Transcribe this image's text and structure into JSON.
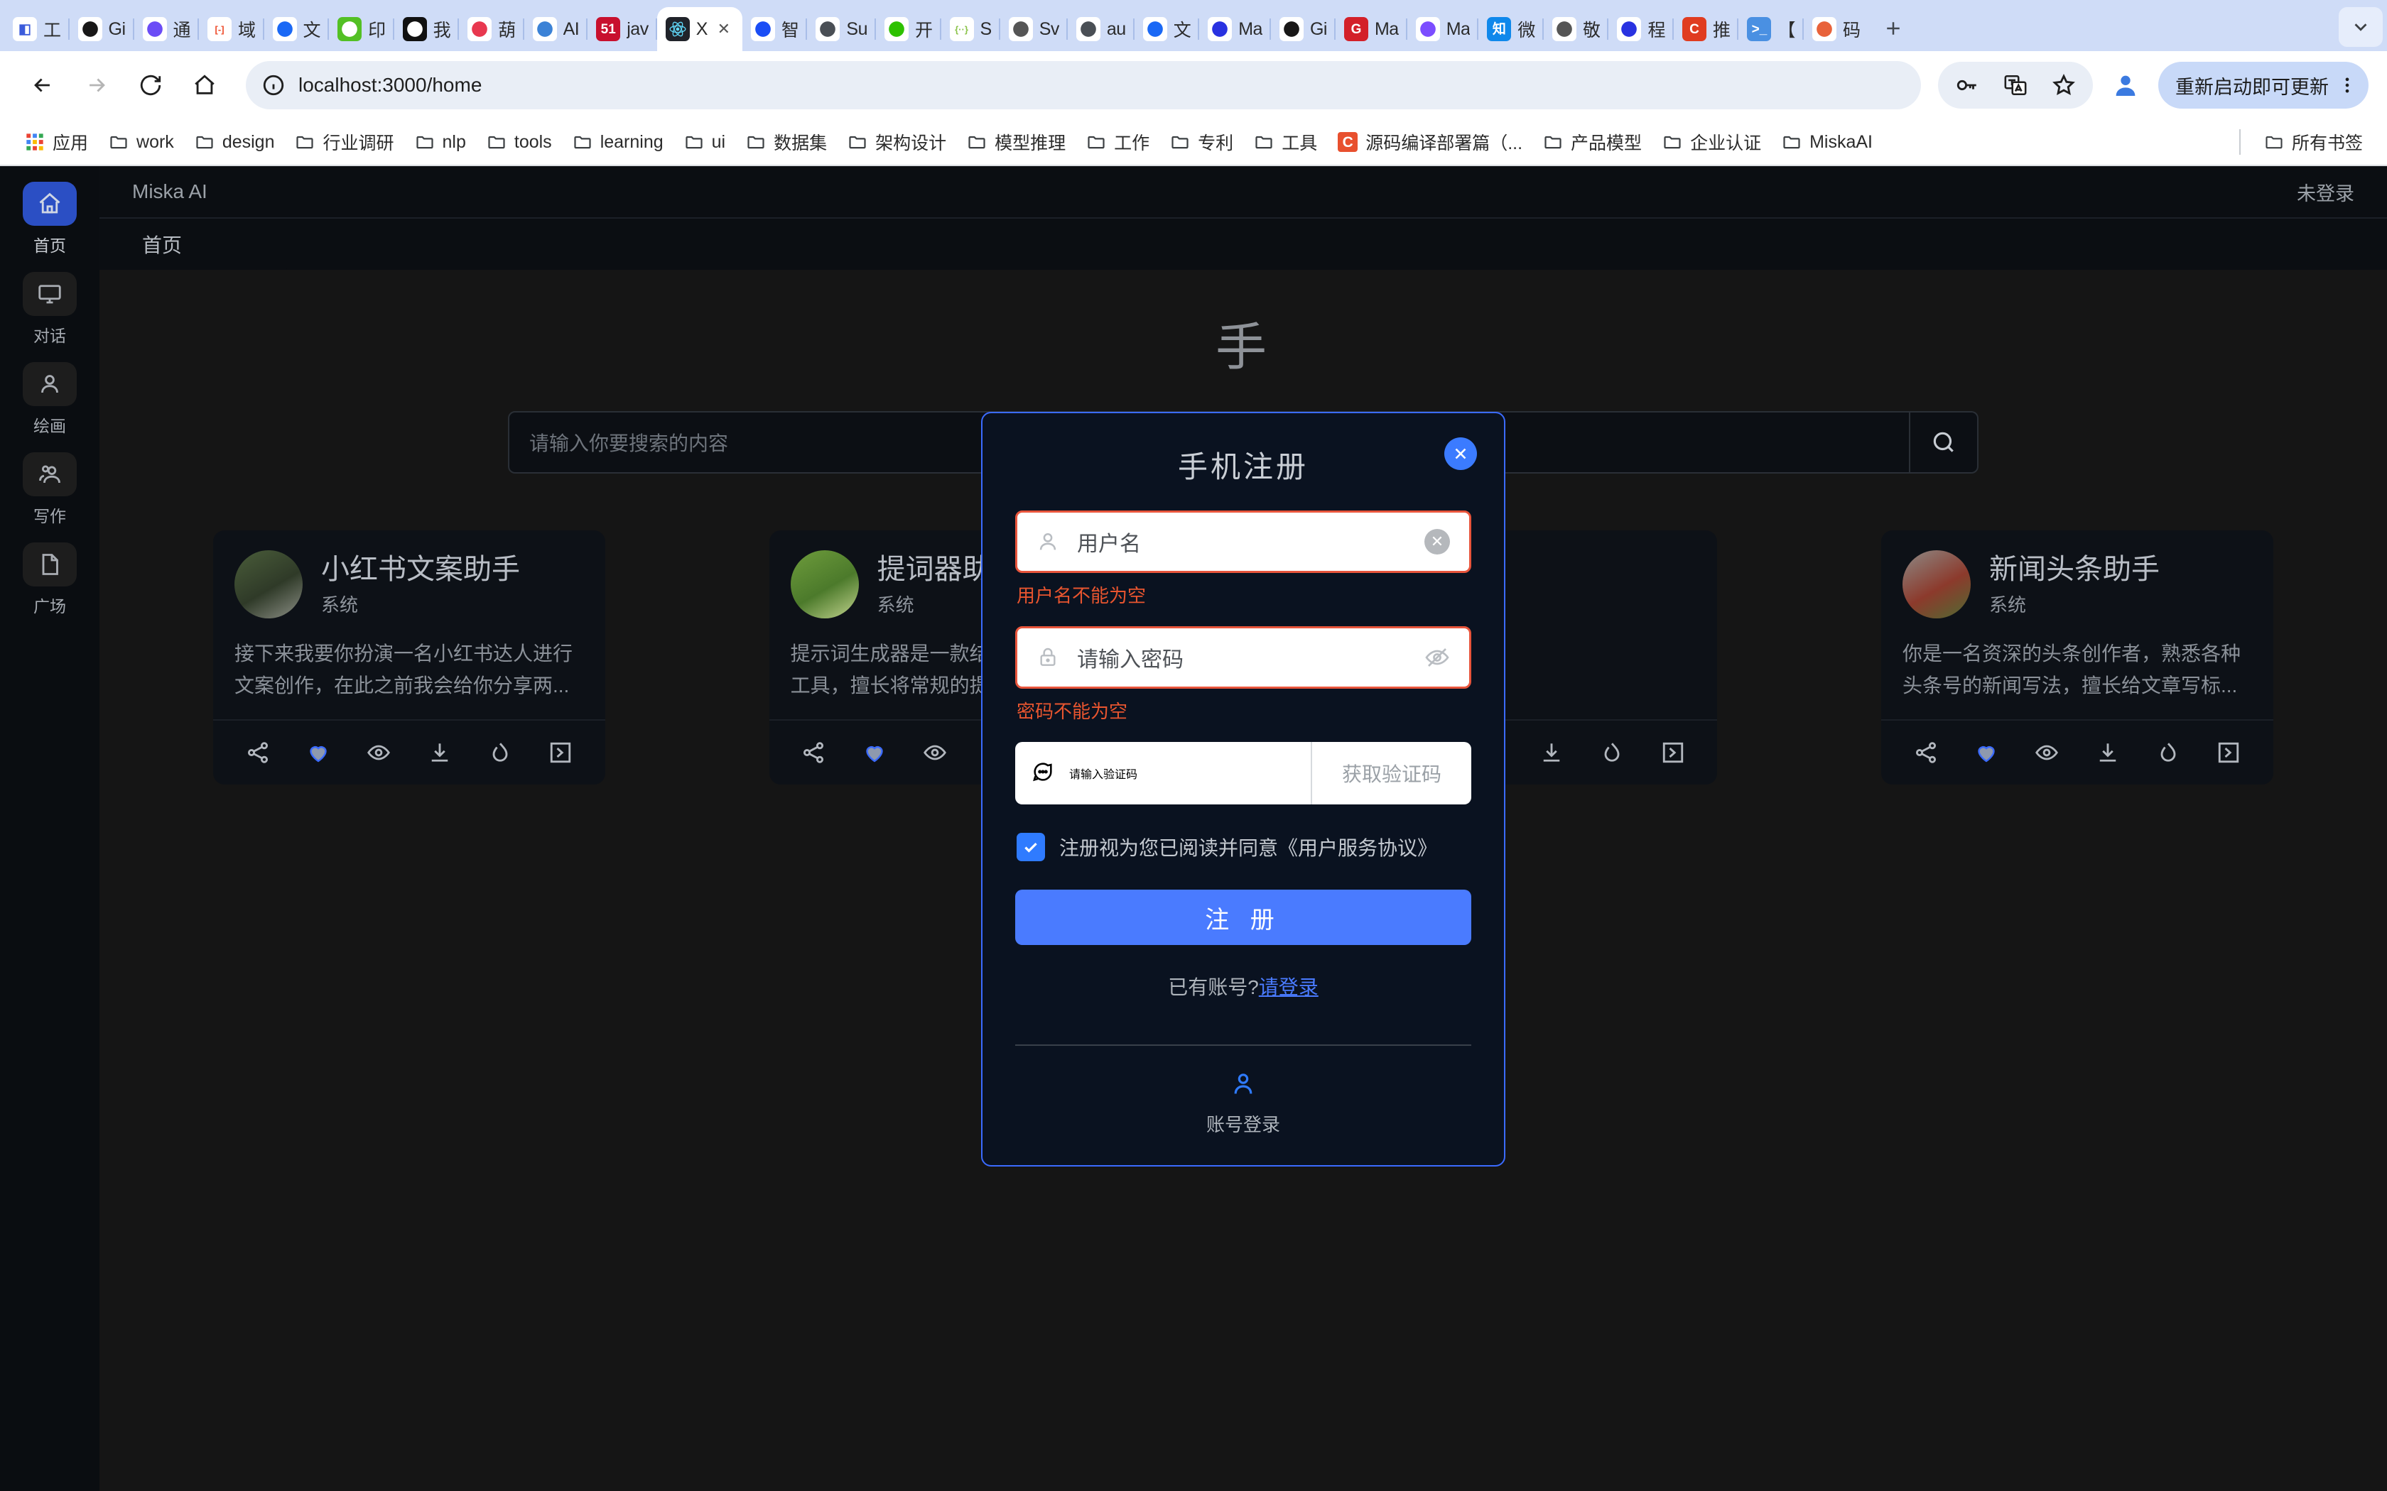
{
  "browser": {
    "tabs": [
      {
        "title": "工",
        "icon": "book-icon",
        "bg": "#ffffff",
        "glyph": "◧",
        "color": "#3b5bdb",
        "active": false
      },
      {
        "title": "Gi",
        "icon": "github-icon",
        "bg": "#ffffff",
        "glyph": "",
        "color": "#181717",
        "active": false
      },
      {
        "title": "通",
        "icon": "feishu-icon",
        "bg": "#ffffff",
        "glyph": "",
        "color": "#6b4cf6",
        "active": false
      },
      {
        "title": "域",
        "icon": "domain-icon",
        "bg": "#ffffff",
        "glyph": "[-]",
        "color": "#ee4d2d",
        "active": false
      },
      {
        "title": "文",
        "icon": "yuque-icon",
        "bg": "#ffffff",
        "glyph": "",
        "color": "#1a68f5",
        "active": false
      },
      {
        "title": "印",
        "icon": "evernote-icon",
        "bg": "#53c024",
        "glyph": "",
        "color": "#ffffff",
        "active": false
      },
      {
        "title": "我",
        "icon": "black-circle-icon",
        "bg": "#111111",
        "glyph": "",
        "color": "#ffffff",
        "active": false
      },
      {
        "title": "葫",
        "icon": "bulb-icon",
        "bg": "#ffffff",
        "glyph": "",
        "color": "#e8384f",
        "active": false
      },
      {
        "title": "AI",
        "icon": "triangle-a-icon",
        "bg": "#ffffff",
        "glyph": "",
        "color": "#3b82d6",
        "active": false
      },
      {
        "title": "jav",
        "icon": "51cto-icon",
        "bg": "#c8102e",
        "glyph": "51",
        "color": "#ffffff",
        "active": false
      },
      {
        "title": "X",
        "icon": "react-icon",
        "bg": "#20232a",
        "glyph": "",
        "color": "#61dafb",
        "active": true
      },
      {
        "title": "智",
        "icon": "zhihu-blue-icon",
        "bg": "#ffffff",
        "glyph": "",
        "color": "#1a4df5",
        "active": false
      },
      {
        "title": "Su",
        "icon": "globe-icon",
        "bg": "#ffffff",
        "glyph": "",
        "color": "#4a4f55",
        "active": false
      },
      {
        "title": "开",
        "icon": "wechat-icon",
        "bg": "#ffffff",
        "glyph": "",
        "color": "#2dc100",
        "active": false
      },
      {
        "title": "S",
        "icon": "curly-brace-icon",
        "bg": "#ffffff",
        "glyph": "{··}",
        "color": "#8bc34a",
        "active": false
      },
      {
        "title": "Sv",
        "icon": "plain-icon",
        "bg": "#ffffff",
        "glyph": "",
        "color": "#555555",
        "active": false
      },
      {
        "title": "au",
        "icon": "globe-icon",
        "bg": "#ffffff",
        "glyph": "",
        "color": "#4a4f55",
        "active": false
      },
      {
        "title": "文",
        "icon": "yuque-icon",
        "bg": "#ffffff",
        "glyph": "",
        "color": "#1a68f5",
        "active": false
      },
      {
        "title": "Ma",
        "icon": "baidu-icon",
        "bg": "#ffffff",
        "glyph": "",
        "color": "#2932e1",
        "active": false
      },
      {
        "title": "Gi",
        "icon": "github-icon",
        "bg": "#ffffff",
        "glyph": "",
        "color": "#181717",
        "active": false
      },
      {
        "title": "Ma",
        "icon": "g-red-icon",
        "bg": "#d32029",
        "glyph": "G",
        "color": "#ffffff",
        "active": false
      },
      {
        "title": "Ma",
        "icon": "monitor-purple-icon",
        "bg": "#ffffff",
        "glyph": "",
        "color": "#7c4dff",
        "active": false
      },
      {
        "title": "微",
        "icon": "zhihu-icon",
        "bg": "#0f88eb",
        "glyph": "知",
        "color": "#ffffff",
        "active": false
      },
      {
        "title": "敬",
        "icon": "plain-icon",
        "bg": "#ffffff",
        "glyph": "",
        "color": "#555555",
        "active": false
      },
      {
        "title": "程",
        "icon": "baidu-icon",
        "bg": "#ffffff",
        "glyph": "",
        "color": "#2932e1",
        "active": false
      },
      {
        "title": "推",
        "icon": "c-red-icon",
        "bg": "#e03c20",
        "glyph": "C",
        "color": "#ffffff",
        "active": false
      },
      {
        "title": "【",
        "icon": "terminal-icon",
        "bg": "#4a90e2",
        "glyph": ">_",
        "color": "#ffffff",
        "active": false
      },
      {
        "title": "码",
        "icon": "mountain-icon",
        "bg": "#ffffff",
        "glyph": "",
        "color": "#e8623a",
        "active": false
      }
    ],
    "new_tab_label": "+",
    "tab_list_chevron": "chevron-down-icon",
    "nav": {
      "back": "back-arrow-icon",
      "forward": "forward-arrow-icon",
      "reload": "reload-icon",
      "home": "home-icon"
    },
    "omnibox": {
      "info_icon": "info-circle-icon",
      "url": "localhost:3000/home"
    },
    "toolbar_right": {
      "password_icon": "key-icon",
      "translate_icon": "translate-icon",
      "bookmark_icon": "star-icon",
      "profile_icon": "profile-avatar-icon",
      "update_label": "重新启动即可更新",
      "menu_icon": "kebab-menu-icon"
    },
    "bookmarks": [
      {
        "label": "应用",
        "icon": "apps-grid-icon"
      },
      {
        "label": "work",
        "icon": "folder-icon"
      },
      {
        "label": "design",
        "icon": "folder-icon"
      },
      {
        "label": "行业调研",
        "icon": "folder-icon"
      },
      {
        "label": "nlp",
        "icon": "folder-icon"
      },
      {
        "label": "tools",
        "icon": "folder-icon"
      },
      {
        "label": "learning",
        "icon": "folder-icon"
      },
      {
        "label": "ui",
        "icon": "folder-icon"
      },
      {
        "label": "数据集",
        "icon": "folder-icon"
      },
      {
        "label": "架构设计",
        "icon": "folder-icon"
      },
      {
        "label": "模型推理",
        "icon": "folder-icon"
      },
      {
        "label": "工作",
        "icon": "folder-icon"
      },
      {
        "label": "专利",
        "icon": "folder-icon"
      },
      {
        "label": "工具",
        "icon": "folder-icon"
      },
      {
        "label": "源码编译部署篇（...",
        "icon": "csdn-icon"
      },
      {
        "label": "产品模型",
        "icon": "folder-icon"
      },
      {
        "label": "企业认证",
        "icon": "folder-icon"
      },
      {
        "label": "MiskaAI",
        "icon": "folder-icon"
      }
    ],
    "bookmarks_all": {
      "label": "所有书签",
      "icon": "folder-icon"
    }
  },
  "app": {
    "name": "Miska AI",
    "login_status": "未登录",
    "tabs": [
      {
        "label": "首页"
      }
    ],
    "hero_title": "手",
    "search": {
      "placeholder": "请输入你要搜索的内容",
      "button_icon": "search-icon"
    }
  },
  "sidebar": {
    "items": [
      {
        "label": "首页",
        "icon": "home-icon",
        "active": true
      },
      {
        "label": "对话",
        "icon": "monitor-icon",
        "active": false
      },
      {
        "label": "绘画",
        "icon": "person-icon",
        "active": false
      },
      {
        "label": "写作",
        "icon": "people-icon",
        "active": false
      },
      {
        "label": "广场",
        "icon": "document-icon",
        "active": false
      }
    ]
  },
  "cards": [
    {
      "title": "小红书文案助手",
      "subtitle": "系统",
      "description": "接下来我要你扮演一名小红书达人进行文案创作，在此之前我会给你分享两...",
      "avatar": "panda-avatar",
      "avatar_colors": [
        "#4a5d3a",
        "#2f3a28",
        "#8c8f86"
      ],
      "actions": [
        "share-icon",
        "heart-icon",
        "eye-icon",
        "download-icon",
        "fire-icon",
        "arrow-right-box-icon"
      ]
    },
    {
      "title": "提词器助手",
      "subtitle": "系统",
      "description": "提示词生成器是一款结构化提示词生成工具，擅长将常规的提示词转化成结...",
      "avatar": "village-avatar",
      "avatar_colors": [
        "#6e9c3c",
        "#4c7a2b",
        "#c3d48f"
      ],
      "actions": [
        "share-icon",
        "heart-icon",
        "eye-icon",
        "download-icon",
        "fire-icon",
        "arrow-right-box-icon"
      ]
    },
    {
      "title": "",
      "subtitle": "",
      "description": "",
      "avatar": "hidden-avatar",
      "avatar_colors": [
        "#2a2f36",
        "#1b2027",
        "#3a4049"
      ],
      "actions": [
        "share-icon",
        "heart-icon",
        "eye-icon",
        "download-icon",
        "fire-icon",
        "arrow-right-box-icon"
      ]
    },
    {
      "title": "新闻头条助手",
      "subtitle": "系统",
      "description": "你是一名资深的头条创作者，熟悉各种头条号的新闻写法，擅长给文章写标...",
      "avatar": "flowerbed-avatar",
      "avatar_colors": [
        "#8d8a86",
        "#8c3a2c",
        "#4f6b32"
      ],
      "actions": [
        "share-icon",
        "heart-icon",
        "eye-icon",
        "download-icon",
        "fire-icon",
        "arrow-right-box-icon"
      ]
    }
  ],
  "modal": {
    "title": "手机注册",
    "close_icon": "close-icon",
    "username": {
      "icon": "person-icon",
      "placeholder": "用户名",
      "clear_icon": "clear-circle-icon",
      "error": "用户名不能为空"
    },
    "password": {
      "icon": "lock-icon",
      "placeholder": "请输入密码",
      "toggle_icon": "eye-off-icon",
      "error": "密码不能为空"
    },
    "captcha": {
      "icon": "chat-bubble-icon",
      "placeholder": "请输入验证码",
      "button_label": "获取验证码"
    },
    "agreement": {
      "checked": true,
      "check_icon": "check-icon",
      "text": "注册视为您已阅读并同意《用户服务协议》"
    },
    "submit_label": "注 册",
    "have_account_text": "已有账号?",
    "login_link": "请登录",
    "alt_login": {
      "icon": "person-icon",
      "label": "账号登录"
    }
  },
  "colors": {
    "accent_blue": "#4a7bff",
    "error_red": "#e8552f",
    "dark_bg": "#151515",
    "panel_bg": "#0b0e12",
    "modal_bg": "#0a1220"
  }
}
